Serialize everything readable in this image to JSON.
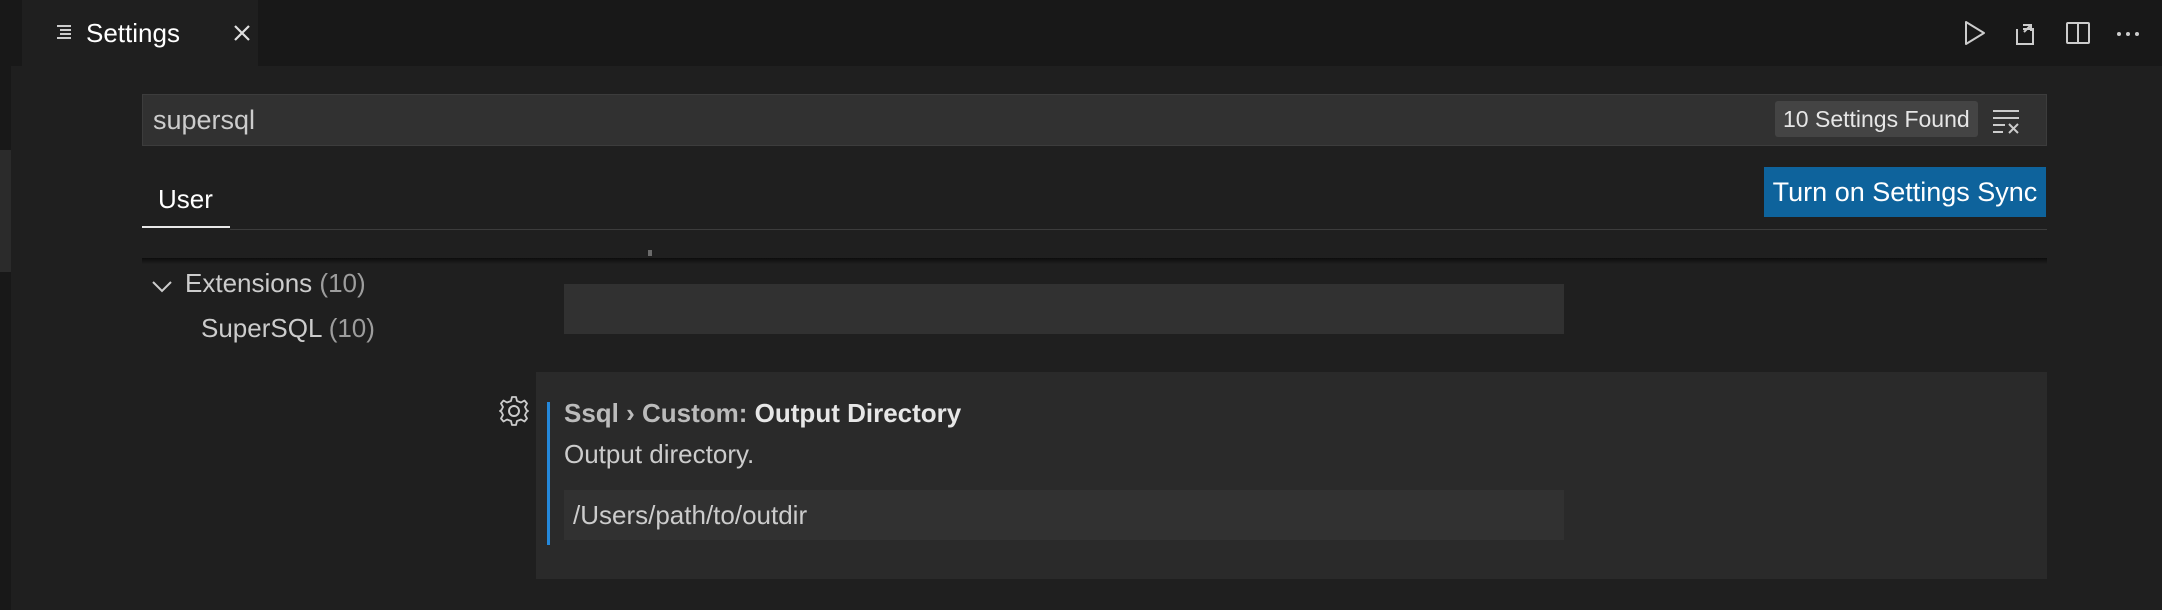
{
  "tab": {
    "title": "Settings",
    "icon": "settings-editor-icon",
    "close_icon": "close-icon"
  },
  "editor_actions": [
    {
      "icon": "run-icon"
    },
    {
      "icon": "open-settings-json-icon"
    },
    {
      "icon": "split-editor-icon"
    },
    {
      "icon": "more-actions-icon"
    }
  ],
  "search": {
    "value": "supersql",
    "results_count": "10 Settings Found",
    "clear_icon": "clear-filter-icon"
  },
  "scope": {
    "active_tab": "User",
    "sync_button": "Turn on Settings Sync"
  },
  "toc": {
    "root_label": "Extensions",
    "root_count": "(10)",
    "child_label": "SuperSQL",
    "child_count": "(10)"
  },
  "setting": {
    "category": "Ssql › Custom: ",
    "name": "Output Directory",
    "description": "Output directory.",
    "value": "/Users/path/to/outdir"
  },
  "colors": {
    "background": "#1f1f1f",
    "accent": "#0e639c",
    "focus": "#2488db"
  }
}
